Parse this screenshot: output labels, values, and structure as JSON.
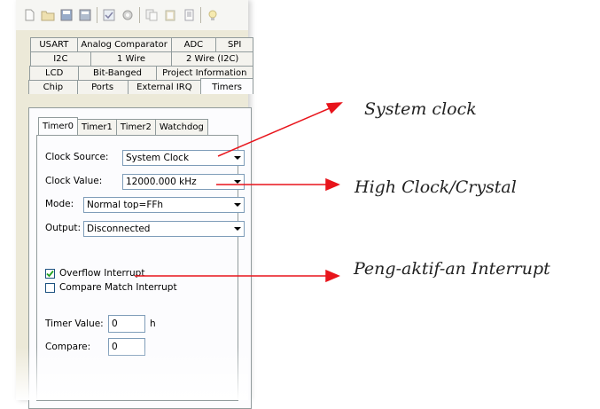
{
  "toolbar": {
    "icons": [
      "new-file-icon",
      "open-folder-icon",
      "save-icon",
      "save-all-icon",
      "check-icon",
      "gear-icon",
      "copy-icon",
      "paste-icon",
      "document-icon",
      "help-icon"
    ]
  },
  "tabs": {
    "row1": [
      "USART",
      "Analog Comparator",
      "ADC",
      "SPI"
    ],
    "row2": [
      "I2C",
      "1 Wire",
      "2 Wire (I2C)"
    ],
    "row3": [
      "LCD",
      "Bit-Banged",
      "Project Information"
    ],
    "row4": [
      "Chip",
      "Ports",
      "External IRQ",
      "Timers"
    ],
    "active": "Timers"
  },
  "timer_tabs": [
    "Timer0",
    "Timer1",
    "Timer2",
    "Watchdog"
  ],
  "timer_active": "Timer0",
  "form": {
    "clock_source_label": "Clock Source:",
    "clock_source_value": "System Clock",
    "clock_value_label": "Clock Value:",
    "clock_value_value": "12000.000 kHz",
    "mode_label": "Mode:",
    "mode_value": "Normal top=FFh",
    "output_label": "Output:",
    "output_value": "Disconnected",
    "overflow_interrupt_label": "Overflow Interrupt",
    "overflow_interrupt_checked": true,
    "compare_match_label": "Compare Match Interrupt",
    "compare_match_checked": false,
    "timer_value_label": "Timer Value:",
    "timer_value": "0",
    "timer_value_unit": "h",
    "compare_label": "Compare:",
    "compare_value": "0"
  },
  "annotations": {
    "system_clock": "System clock",
    "high_clock": "High Clock/Crystal",
    "interrupt": "Peng-aktif-an Interrupt",
    "arrow_color": "#e8141b"
  }
}
